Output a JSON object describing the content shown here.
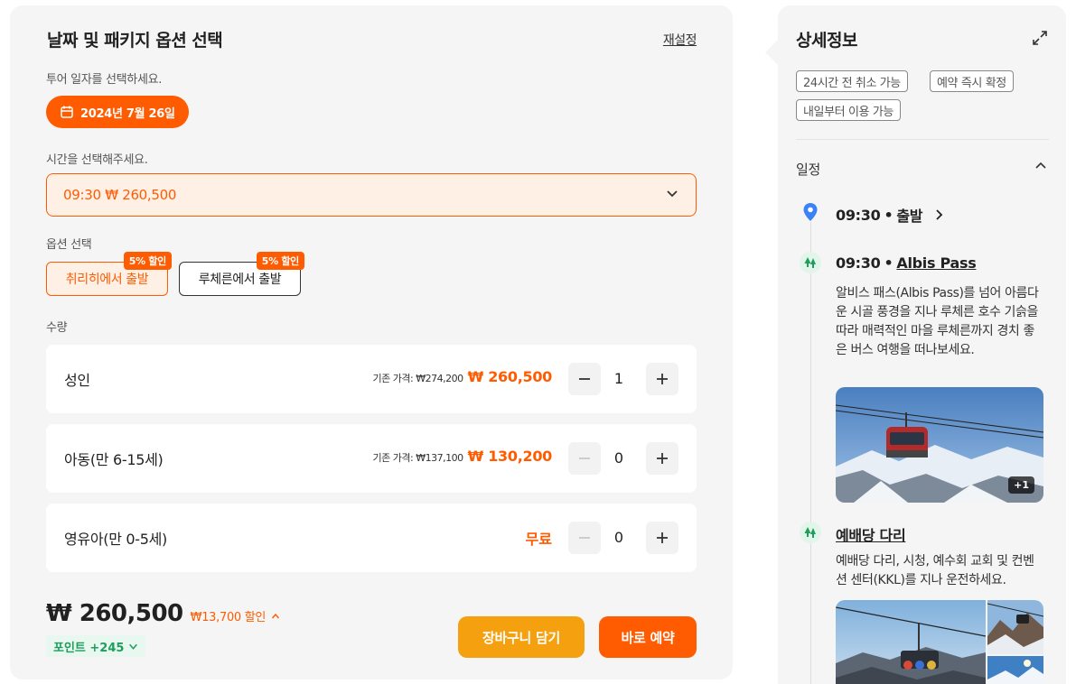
{
  "booking": {
    "title": "날짜 및 패키지 옵션 선택",
    "reset_label": "재설정",
    "date_label": "투어 일자를 선택하세요.",
    "selected_date": "2024년 7월 26일",
    "time_label": "시간을 선택해주세요.",
    "selected_time": "09:30 ₩ 260,500",
    "option_label": "옵션 선택",
    "options": [
      {
        "label": "취리히에서 출발",
        "badge": "5% 할인",
        "selected": true
      },
      {
        "label": "루체른에서 출발",
        "badge": "5% 할인",
        "selected": false
      }
    ],
    "quantity_label": "수량",
    "quantities": [
      {
        "name": "성인",
        "orig_price": "기존 가격: ₩274,200",
        "price": "₩ 260,500",
        "count": "1"
      },
      {
        "name": "아동(만 6-15세)",
        "orig_price": "기존 가격: ₩137,100",
        "price": "₩ 130,200",
        "count": "0"
      },
      {
        "name": "영유아(만 0-5세)",
        "free_label": "무료",
        "count": "0"
      }
    ],
    "total_amount": "₩ 260,500",
    "discount_text": "₩13,700 할인",
    "points_text": "포인트 +245",
    "cart_button": "장바구니 담기",
    "book_button": "바로 예약"
  },
  "details": {
    "title": "상세정보",
    "tags": [
      "24시간 전 취소 가능",
      "예약 즉시 확정",
      "내일부터 이용 가능"
    ],
    "schedule_title": "일정",
    "timeline": [
      {
        "time": "09:30",
        "label": "출발"
      },
      {
        "time": "09:30",
        "label": "Albis Pass",
        "desc": "알비스 패스(Albis Pass)를 넘어 아름다운 시골 풍경을 지나 루체른 호수 기슭을 따라 매력적인 마을 루체른까지 경치 좋은 버스 여행을 떠나보세요.",
        "more_photos": "+1"
      },
      {
        "label": "예배당 다리",
        "desc": "예배당 다리, 시청, 예수회 교회 및 컨벤션 센터(KKL)를 지나 운전하세요."
      }
    ]
  },
  "colors": {
    "accent": "#ff5b00",
    "cart": "#f5a00f",
    "points_green": "#1e9e5a"
  }
}
